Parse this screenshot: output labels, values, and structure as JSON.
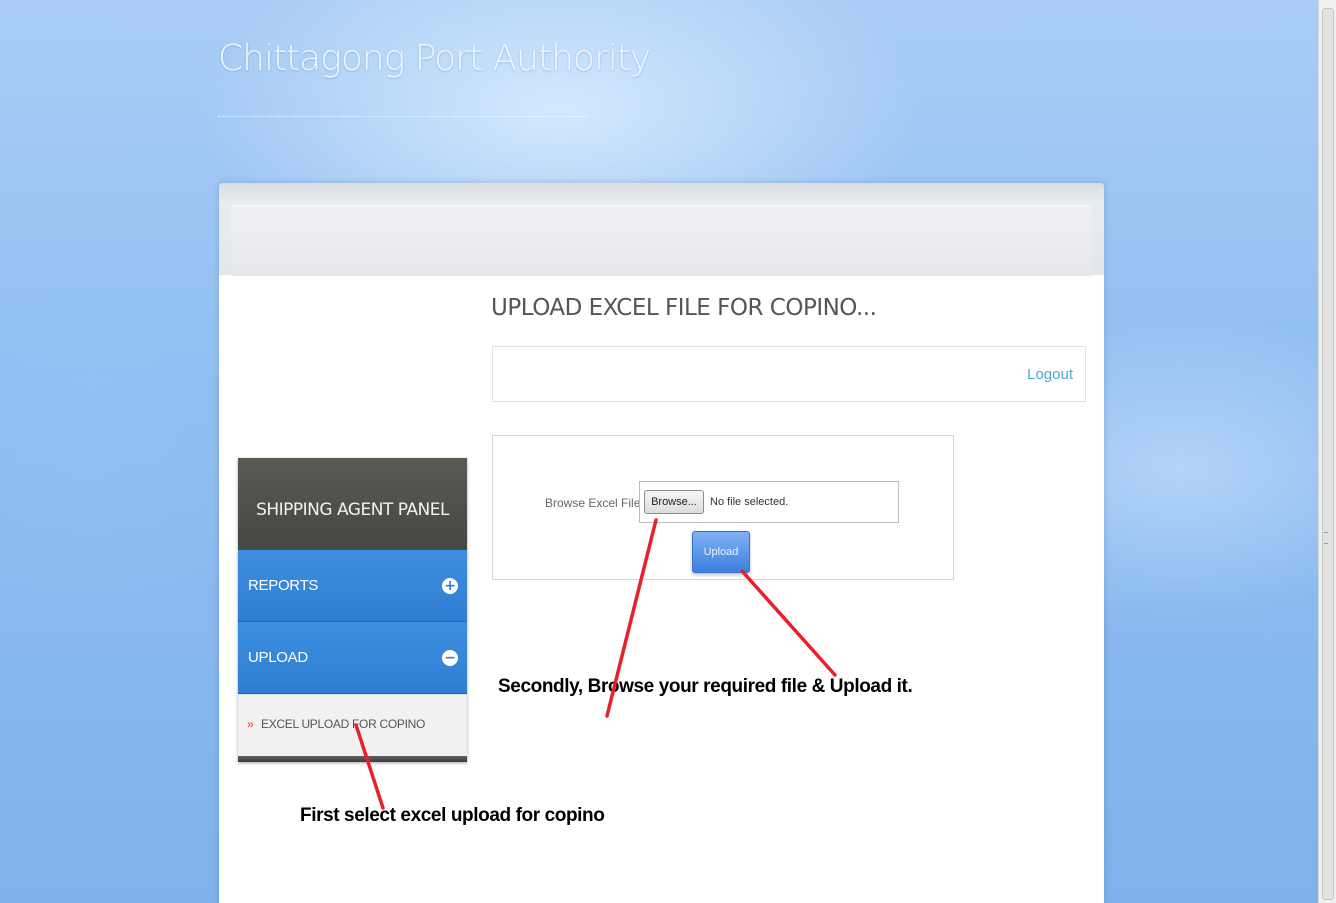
{
  "site": {
    "title": "Chittagong Port Authority"
  },
  "page": {
    "heading": "UPLOAD EXCEL FILE FOR COPINO...",
    "logout_label": "Logout"
  },
  "upload_form": {
    "browse_label": "Browse Excel File",
    "browse_button": "Browse...",
    "file_status": "No file selected.",
    "upload_button": "Upload"
  },
  "sidebar": {
    "header": "SHIPPING AGENT PANEL",
    "items": [
      {
        "label": "REPORTS",
        "toggle": "+",
        "state": "collapsed"
      },
      {
        "label": "UPLOAD",
        "toggle": "−",
        "state": "expanded"
      }
    ],
    "sub_items": [
      {
        "bullet": "»",
        "label": "EXCEL UPLOAD FOR COPINO"
      }
    ]
  },
  "annotations": {
    "second": "Secondly, Browse your required file & Upload it.",
    "first": "First select excel upload for copino",
    "arrow_color": "#e8202a"
  },
  "colors": {
    "nav_blue": "#2f7dd3",
    "panel_header_dark": "#474742",
    "link_blue": "#4aa8d8",
    "bullet_red": "#d04a3a"
  }
}
